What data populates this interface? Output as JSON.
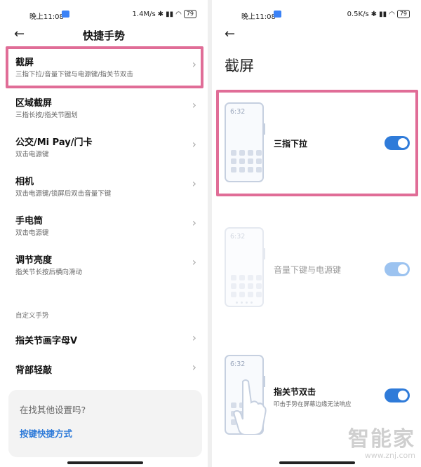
{
  "left": {
    "status": {
      "time": "晚上11:08",
      "net": "1.4M/s",
      "battery": "79"
    },
    "title": "快捷手势",
    "items": [
      {
        "title": "截屏",
        "sub": "三指下拉/音量下键与电源键/指关节双击"
      },
      {
        "title": "区域截屏",
        "sub": "三指长按/指关节圈划"
      },
      {
        "title": "公交/Mi Pay/门卡",
        "sub": "双击电源键"
      },
      {
        "title": "相机",
        "sub": "双击电源键/锁屏后双击音量下键"
      },
      {
        "title": "手电筒",
        "sub": "双击电源键"
      },
      {
        "title": "调节亮度",
        "sub": "指关节长按后横向滑动"
      }
    ],
    "section": "自定义手势",
    "custom_items": [
      {
        "title": "指关节画字母V"
      },
      {
        "title": "背部轻敲"
      }
    ],
    "help": {
      "question": "在找其他设置吗?",
      "link": "按键快捷方式"
    }
  },
  "right": {
    "status": {
      "time": "晚上11:08",
      "net": "0.5K/s",
      "battery": "79"
    },
    "title": "截屏",
    "phone_time": "6:32",
    "options": [
      {
        "label": "三指下拉",
        "sub": "",
        "enabled": true,
        "on": true
      },
      {
        "label": "音量下键与电源键",
        "sub": "",
        "enabled": false,
        "on": true
      },
      {
        "label": "指关节双击",
        "sub": "叩击手势在屏幕边缘无法响应",
        "enabled": true,
        "on": true
      }
    ]
  },
  "watermark": {
    "main": "智能家",
    "sub": "www.znj.com"
  },
  "colors": {
    "accent": "#2f7bd9",
    "highlight": "#e06d97"
  }
}
